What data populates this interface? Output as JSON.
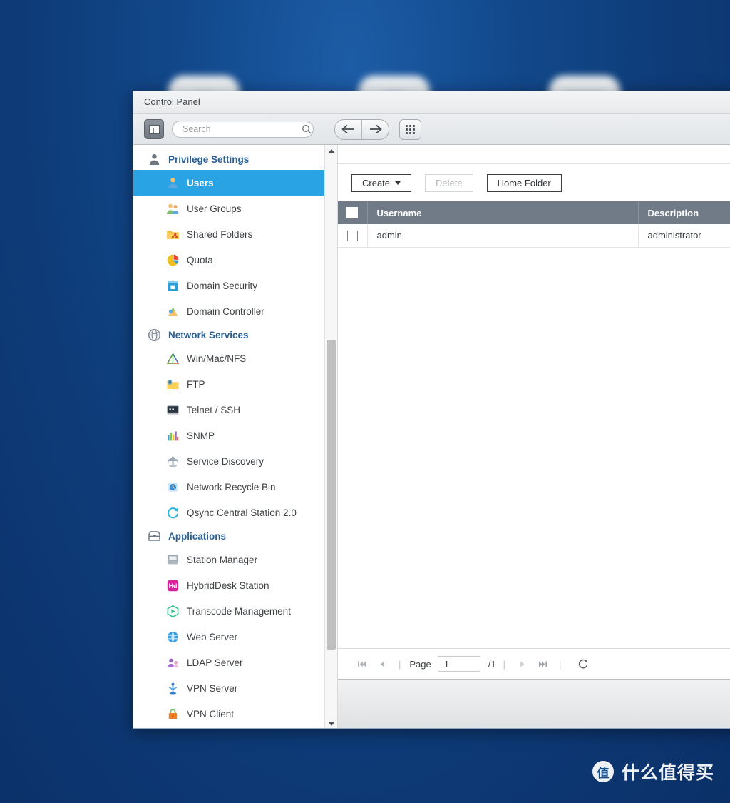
{
  "window": {
    "title": "Control Panel"
  },
  "toolbar": {
    "panel_toggle_name": "panel-toggle",
    "search_placeholder": "Search",
    "search_value": "",
    "back_label": "←",
    "forward_label": "→"
  },
  "sidebar": {
    "sections": [
      {
        "name": "privilege-settings",
        "label": "Privilege Settings",
        "icon": "user-silhouette-icon",
        "items": [
          {
            "name": "users",
            "label": "Users",
            "icon": "user-icon",
            "active": true
          },
          {
            "name": "user-groups",
            "label": "User Groups",
            "icon": "user-groups-icon",
            "active": false
          },
          {
            "name": "shared-folders",
            "label": "Shared Folders",
            "icon": "shared-folder-icon",
            "active": false
          },
          {
            "name": "quota",
            "label": "Quota",
            "icon": "quota-pie-icon",
            "active": false
          },
          {
            "name": "domain-security",
            "label": "Domain Security",
            "icon": "domain-security-icon",
            "active": false
          },
          {
            "name": "domain-controller",
            "label": "Domain Controller",
            "icon": "domain-controller-icon",
            "active": false
          }
        ]
      },
      {
        "name": "network-services",
        "label": "Network Services",
        "icon": "globe-icon",
        "items": [
          {
            "name": "win-mac-nfs",
            "label": "Win/Mac/NFS",
            "icon": "triangle-network-icon",
            "active": false
          },
          {
            "name": "ftp",
            "label": "FTP",
            "icon": "ftp-folder-icon",
            "active": false
          },
          {
            "name": "telnet-ssh",
            "label": "Telnet / SSH",
            "icon": "terminal-icon",
            "active": false
          },
          {
            "name": "snmp",
            "label": "SNMP",
            "icon": "bar-chart-icon",
            "active": false
          },
          {
            "name": "service-discovery",
            "label": "Service Discovery",
            "icon": "radar-icon",
            "active": false
          },
          {
            "name": "network-recycle-bin",
            "label": "Network Recycle Bin",
            "icon": "recycle-bin-icon",
            "active": false
          },
          {
            "name": "qsync-central-station",
            "label": "Qsync Central Station 2.0",
            "icon": "sync-icon",
            "active": false
          }
        ]
      },
      {
        "name": "applications",
        "label": "Applications",
        "icon": "app-box-icon",
        "items": [
          {
            "name": "station-manager",
            "label": "Station Manager",
            "icon": "station-manager-icon",
            "active": false
          },
          {
            "name": "hybriddesk-station",
            "label": "HybridDesk Station",
            "icon": "hybriddesk-icon",
            "active": false
          },
          {
            "name": "transcode-management",
            "label": "Transcode Management",
            "icon": "transcode-icon",
            "active": false
          },
          {
            "name": "web-server",
            "label": "Web Server",
            "icon": "web-server-globe-icon",
            "active": false
          },
          {
            "name": "ldap-server",
            "label": "LDAP Server",
            "icon": "ldap-icon",
            "active": false
          },
          {
            "name": "vpn-server",
            "label": "VPN Server",
            "icon": "vpn-server-icon",
            "active": false
          },
          {
            "name": "vpn-client",
            "label": "VPN Client",
            "icon": "vpn-client-lock-icon",
            "active": false
          }
        ]
      }
    ]
  },
  "main": {
    "buttons": {
      "create": "Create",
      "delete": "Delete",
      "home_folder": "Home Folder"
    },
    "table": {
      "columns": [
        "Username",
        "Description"
      ],
      "rows": [
        {
          "username": "admin",
          "description": "administrator",
          "checked": false
        }
      ]
    },
    "pager": {
      "first": "⏮",
      "prev": "◀",
      "page_label": "Page",
      "page_value": "1",
      "page_total": "/1",
      "next": "▶",
      "last": "⏭",
      "refresh": "refresh-icon"
    }
  },
  "watermark": {
    "logo_char": "值",
    "text": "什么值得买"
  },
  "colors": {
    "desktop": "#0e3f7e",
    "accent": "#29a3e3",
    "table_header": "#717a87",
    "section_label": "#2a6096"
  }
}
